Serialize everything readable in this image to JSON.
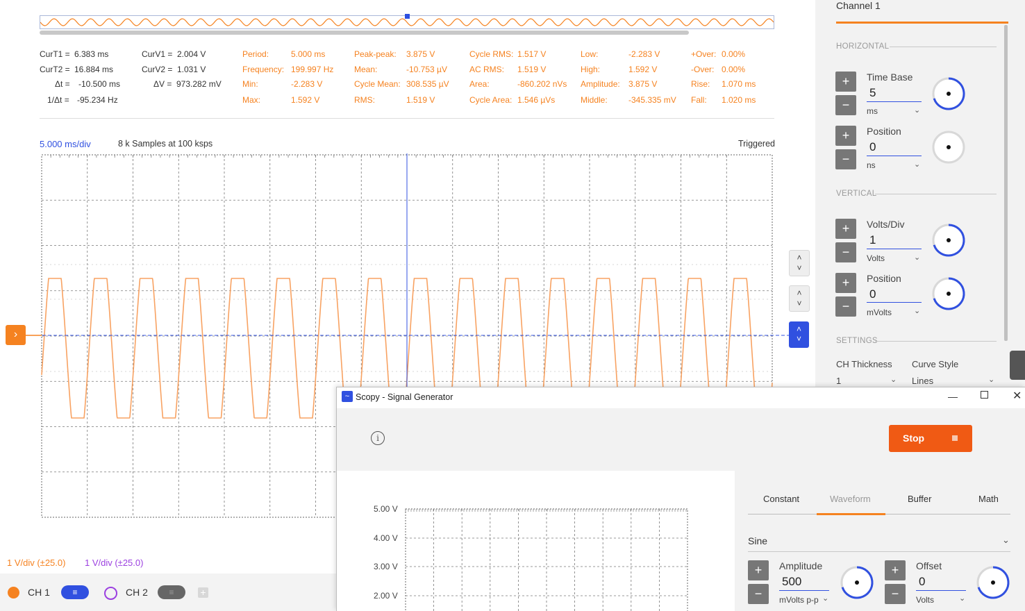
{
  "measurements": {
    "cursors": {
      "curt1_label": "CurT1 =",
      "curt1_value": "6.383 ms",
      "curt2_label": "CurT2 =",
      "curt2_value": "16.884 ms",
      "dt_label": "Δt =",
      "dt_value": "-10.500 ms",
      "inv_dt_label": "1/Δt =",
      "inv_dt_value": "-95.234 Hz",
      "curv1_label": "CurV1 =",
      "curv1_value": "2.004 V",
      "curv2_label": "CurV2 =",
      "curv2_value": "1.031 V",
      "dv_label": "ΔV =",
      "dv_value": "973.282 mV"
    },
    "stats": [
      {
        "label": "Period:",
        "value": "5.000 ms"
      },
      {
        "label": "Frequency:",
        "value": "199.997 Hz"
      },
      {
        "label": "Min:",
        "value": "-2.283 V"
      },
      {
        "label": "Max:",
        "value": "1.592 V"
      },
      {
        "label": "Peak-peak:",
        "value": "3.875 V"
      },
      {
        "label": "Mean:",
        "value": "-10.753 µV"
      },
      {
        "label": "Cycle Mean:",
        "value": "308.535 µV"
      },
      {
        "label": "RMS:",
        "value": "1.519 V"
      },
      {
        "label": "Cycle RMS:",
        "value": "1.517 V"
      },
      {
        "label": "AC RMS:",
        "value": "1.519 V"
      },
      {
        "label": "Area:",
        "value": "-860.202 nVs"
      },
      {
        "label": "Cycle Area:",
        "value": "1.546 µVs"
      },
      {
        "label": "Low:",
        "value": "-2.283 V"
      },
      {
        "label": "High:",
        "value": "1.592 V"
      },
      {
        "label": "Amplitude:",
        "value": "3.875 V"
      },
      {
        "label": "Middle:",
        "value": "-345.335 mV"
      },
      {
        "label": "+Over:",
        "value": "0.00%"
      },
      {
        "label": "-Over:",
        "value": "0.00%"
      },
      {
        "label": "Rise:",
        "value": "1.070 ms"
      },
      {
        "label": "Fall:",
        "value": "1.020 ms"
      }
    ]
  },
  "plot": {
    "timebase": "5.000 ms/div",
    "samples": "8 k Samples at 100 ksps",
    "status": "Triggered",
    "scale_ch1": "1 V/div (±25.0)",
    "scale_ch2": "1 V/div (±25.0)",
    "colors": {
      "ch1": "#f58220",
      "ch2": "#9b3fe0",
      "accent": "#3050e0"
    }
  },
  "channels": {
    "ch1_label": "CH 1",
    "ch2_label": "CH 2"
  },
  "panel": {
    "title": "Channel 1",
    "horizontal": "HORIZONTAL",
    "vertical": "VERTICAL",
    "settings": "SETTINGS",
    "time_base_label": "Time Base",
    "time_base_value": "5",
    "time_base_unit": "ms",
    "h_position_label": "Position",
    "h_position_value": "0",
    "h_position_unit": "ns",
    "volts_div_label": "Volts/Div",
    "volts_div_value": "1",
    "volts_div_unit": "Volts",
    "v_position_label": "Position",
    "v_position_value": "0",
    "v_position_unit": "mVolts",
    "ch_thickness_label": "CH Thickness",
    "ch_thickness_value": "1",
    "curve_style_label": "Curve Style",
    "curve_style_value": "Lines"
  },
  "siggen": {
    "window_title": "Scopy - Signal Generator",
    "stop_label": "Stop",
    "tabs": [
      "Constant",
      "Waveform",
      "Buffer",
      "Math"
    ],
    "active_tab": "Waveform",
    "waveform_type": "Sine",
    "amplitude_label": "Amplitude",
    "amplitude_value": "500",
    "amplitude_unit": "mVolts p-p",
    "offset_label": "Offset",
    "offset_value": "0",
    "offset_unit": "Volts",
    "y_ticks": [
      "5.00 V",
      "4.00 V",
      "3.00 V",
      "2.00 V"
    ]
  }
}
